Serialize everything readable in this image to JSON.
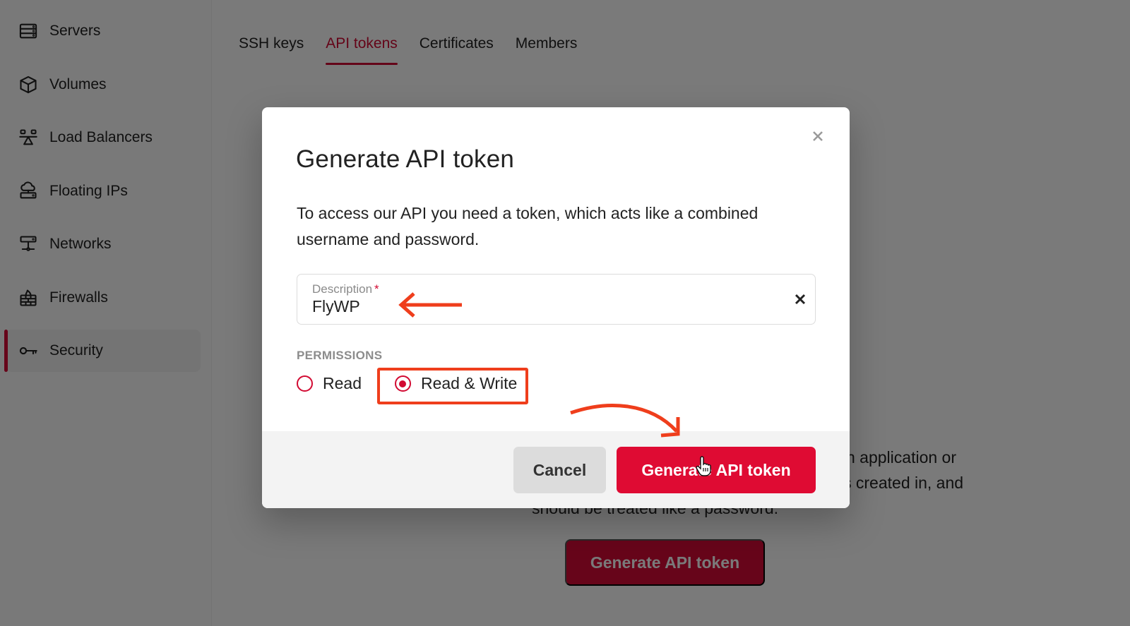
{
  "sidebar": {
    "items": [
      {
        "label": "Servers",
        "icon": "server-icon",
        "active": false
      },
      {
        "label": "Volumes",
        "icon": "cube-icon",
        "active": false
      },
      {
        "label": "Load Balancers",
        "icon": "load-balancer-icon",
        "active": false
      },
      {
        "label": "Floating IPs",
        "icon": "cloud-server-icon",
        "active": false
      },
      {
        "label": "Networks",
        "icon": "network-icon",
        "active": false
      },
      {
        "label": "Firewalls",
        "icon": "firewall-icon",
        "active": false
      },
      {
        "label": "Security",
        "icon": "key-icon",
        "active": true
      }
    ]
  },
  "tabs": [
    {
      "label": "SSH keys",
      "active": false
    },
    {
      "label": "API tokens",
      "active": true
    },
    {
      "label": "Certificates",
      "active": false
    },
    {
      "label": "Members",
      "active": false
    }
  ],
  "background": {
    "text_line1": "n application or",
    "text_line2": "s created in, and",
    "text_line3": "should be treated like a password.",
    "generate_button": "Generate API token"
  },
  "modal": {
    "title": "Generate API token",
    "description": "To access our API you need a token, which acts like a combined username and password.",
    "close_icon": "close-icon",
    "field": {
      "label": "Description",
      "required_marker": "*",
      "value": "FlyWP",
      "clear_icon": "clear-icon"
    },
    "permissions": {
      "label": "PERMISSIONS",
      "options": [
        {
          "label": "Read",
          "checked": false
        },
        {
          "label": "Read & Write",
          "checked": true
        }
      ]
    },
    "cancel_label": "Cancel",
    "generate_label": "Generate API token"
  },
  "colors": {
    "accent": "#d20a32",
    "button_primary": "#df0b33",
    "annotation": "#ef3e1c",
    "overlay": "rgba(0,0,0,0.52)"
  }
}
